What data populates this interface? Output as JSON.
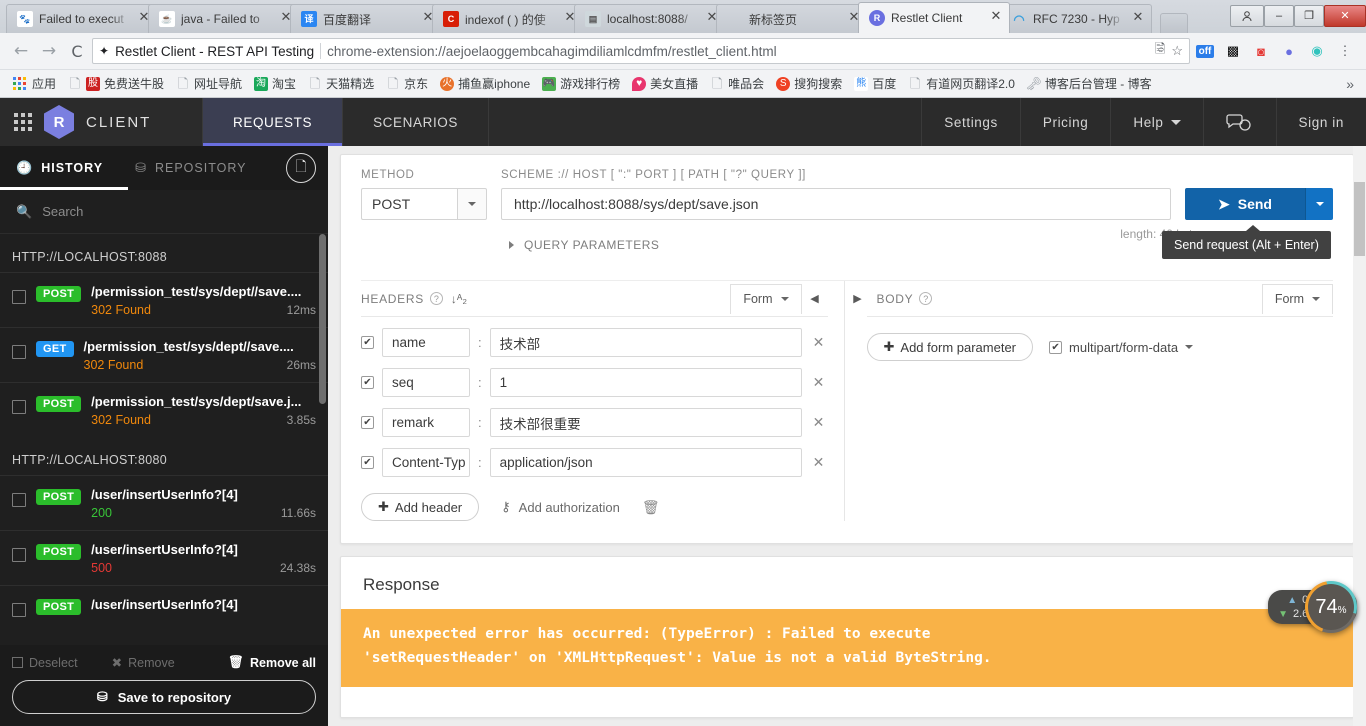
{
  "browser": {
    "tabs": [
      {
        "title": "Failed to execut",
        "favicon": "paw-icon",
        "color": "#ffffff",
        "active": false
      },
      {
        "title": "java - Failed to",
        "favicon": "java-icon",
        "color": "#ffffff",
        "active": false
      },
      {
        "title": "百度翻译",
        "favicon": "translate-icon",
        "color": "#2b86f2",
        "active": false
      },
      {
        "title": "indexof ( ) 的使",
        "favicon": "csdn-icon",
        "color": "#d81e06",
        "active": false
      },
      {
        "title": "localhost:8088/",
        "favicon": "page-icon",
        "color": "#dddddd",
        "active": false
      },
      {
        "title": "新标签页",
        "favicon": "newtab-icon",
        "color": "#ffffff",
        "active": false
      },
      {
        "title": "Restlet Client",
        "favicon": "restlet-icon",
        "color": "#6a6fe0",
        "active": true
      },
      {
        "title": "RFC 7230 - Hyp",
        "favicon": "loading-icon",
        "color": "#ffffff",
        "active": false
      }
    ],
    "tab_close_label": "✕",
    "window_controls": {
      "user": "user-icon",
      "minimize": "–",
      "maximize": "❐",
      "close": "✕"
    },
    "nav": {
      "back": "←",
      "forward": "→",
      "reload": "C"
    },
    "omnibox": {
      "secure_icon": "extension-icon",
      "extension_name": "Restlet Client - REST API Testing",
      "url": "chrome-extension://aejoelaoggembcahagimdiliamlcdmfm/restlet_client.html",
      "translate_icon": "translate-icon",
      "star_icon": "star-icon"
    },
    "extensions": [
      "off-toggle-icon",
      "qrcode-icon",
      "red-app-icon",
      "restlet-icon",
      "green-app-icon",
      "menu-icon"
    ],
    "bookmarks": [
      {
        "label": "应用",
        "icon": "apps-grid-icon",
        "color": ""
      },
      {
        "label": "免费送牛股",
        "icon": "doc-icon",
        "color": "#cc2222",
        "pre": true
      },
      {
        "label": "网址导航",
        "icon": "doc-icon",
        "color": ""
      },
      {
        "label": "淘宝",
        "icon": "taobao-icon",
        "color": "#1aa85a"
      },
      {
        "label": "天猫精选",
        "icon": "doc-icon",
        "color": ""
      },
      {
        "label": "京东",
        "icon": "doc-icon",
        "color": ""
      },
      {
        "label": "捕鱼赢iphone",
        "icon": "fire-icon",
        "color": "#e8712a"
      },
      {
        "label": "游戏排行榜",
        "icon": "game-icon",
        "color": "#4caf50"
      },
      {
        "label": "美女直播",
        "icon": "pin-icon",
        "color": "#e8356d"
      },
      {
        "label": "唯品会",
        "icon": "doc-icon",
        "color": ""
      },
      {
        "label": "搜狗搜索",
        "icon": "sogou-icon",
        "color": "#ef4123"
      },
      {
        "label": "百度",
        "icon": "baidu-icon",
        "color": "#2b86f2"
      },
      {
        "label": "有道网页翻译2.0",
        "icon": "doc-icon",
        "color": ""
      },
      {
        "label": "博客后台管理 - 博客",
        "icon": "key-icon",
        "color": ""
      }
    ],
    "bookmarks_overflow": "»"
  },
  "app": {
    "header": {
      "waffle_icon": "apps-grid-icon",
      "logo_letter": "R",
      "brand": "CLIENT",
      "tabs": [
        {
          "label": "REQUESTS",
          "active": true
        },
        {
          "label": "SCENARIOS",
          "active": false
        }
      ],
      "right_items": [
        {
          "label": "Settings",
          "caret": false
        },
        {
          "label": "Pricing",
          "caret": false
        },
        {
          "label": "Help",
          "caret": true
        }
      ],
      "chat_icon": "chat-bubbles-icon",
      "sign_in": "Sign in"
    },
    "sidebar": {
      "tabs": [
        {
          "label": "HISTORY",
          "icon": "clock-icon",
          "active": true
        },
        {
          "label": "REPOSITORY",
          "icon": "database-icon",
          "active": false
        }
      ],
      "doc_button_icon": "document-icon",
      "search_placeholder": "Search",
      "search_icon": "search-icon",
      "groups": [
        {
          "label": "HTTP://LOCALHOST:8088",
          "items": [
            {
              "method": "POST",
              "path": "/permission_test/sys/dept//save....",
              "status": "302 Found",
              "status_kind": "warn",
              "time": "12ms"
            },
            {
              "method": "GET",
              "path": "/permission_test/sys/dept//save....",
              "status": "302 Found",
              "status_kind": "warn",
              "time": "26ms"
            },
            {
              "method": "POST",
              "path": "/permission_test/sys/dept/save.j...",
              "status": "302 Found",
              "status_kind": "warn",
              "time": "3.85s"
            }
          ]
        },
        {
          "label": "HTTP://LOCALHOST:8080",
          "items": [
            {
              "method": "POST",
              "path": "/user/insertUserInfo?[4]",
              "status": "200",
              "status_kind": "ok",
              "time": "11.66s"
            },
            {
              "method": "POST",
              "path": "/user/insertUserInfo?[4]",
              "status": "500",
              "status_kind": "err",
              "time": "24.38s"
            },
            {
              "method": "POST",
              "path": "/user/insertUserInfo?[4]",
              "status": "",
              "status_kind": "ok",
              "time": ""
            }
          ]
        }
      ],
      "footer": {
        "deselect": "Deselect",
        "remove": "Remove",
        "remove_all": "Remove all",
        "remove_icon": "trash-icon",
        "save_to_repository": "Save to repository",
        "save_icon": "database-icon"
      }
    },
    "request": {
      "method_label": "METHOD",
      "method_value": "POST",
      "url_label": "SCHEME :// HOST [ \":\" PORT ] [ PATH [ \"?\" QUERY ]]",
      "url_value": "http://localhost:8088/sys/dept/save.json",
      "send_label": "Send",
      "send_icon": "paper-plane-icon",
      "send_caret_icon": "chevron-down-icon",
      "length_note": "length: 40 bytes",
      "tooltip": "Send request (Alt + Enter)",
      "query_parameters": "QUERY PARAMETERS"
    },
    "headers_panel": {
      "title": "HEADERS",
      "help_icon": "question-icon",
      "sort_icon": "sort-az-icon",
      "mode": "Form",
      "prev_icon": "chevron-left-icon",
      "next_icon": "chevron-right-icon",
      "rows": [
        {
          "checked": true,
          "key": "name",
          "value": "技术部"
        },
        {
          "checked": true,
          "key": "seq",
          "value": "1"
        },
        {
          "checked": true,
          "key": "remark",
          "value": "技术部很重要"
        },
        {
          "checked": true,
          "key": "Content-Typ",
          "value": "application/json"
        }
      ],
      "add_header": "Add header",
      "add_authorization": "Add authorization",
      "delete_icon": "trash-icon",
      "auth_icon": "key-icon"
    },
    "body_panel": {
      "title": "BODY",
      "help_icon": "question-icon",
      "mode": "Form",
      "add_form_parameter": "Add form parameter",
      "content_type": "multipart/form-data",
      "content_type_checked": true
    },
    "response": {
      "title": "Response",
      "error_line1": "An unexpected error has occurred: (TypeError) : Failed to execute",
      "error_line2": "'setRequestHeader' on 'XMLHttpRequest': Value is not a valid ByteString.",
      "error_bg": "#f9b247"
    },
    "net_widget": {
      "upload": "0",
      "upload_unit": "K/s",
      "download": "2.6",
      "download_unit": "K/s",
      "percent": "74",
      "percent_symbol": "%"
    }
  }
}
